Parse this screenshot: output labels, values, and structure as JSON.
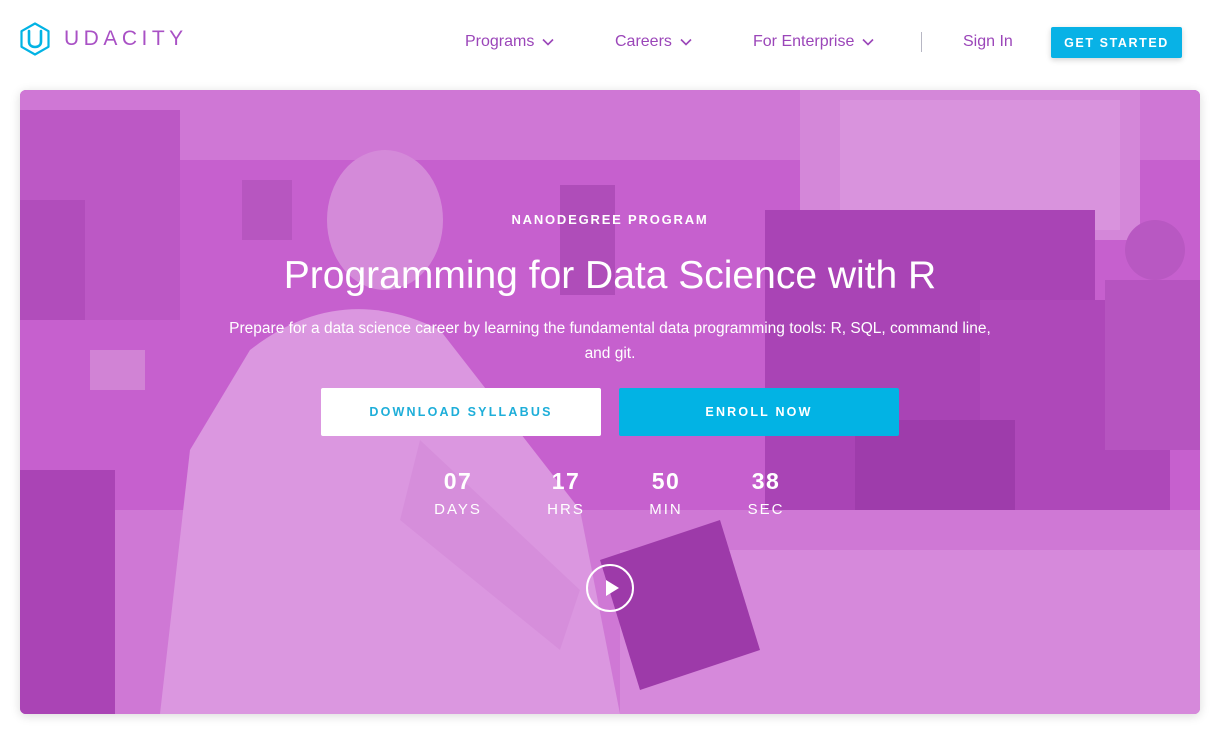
{
  "header": {
    "logo_text": "UDACITY",
    "nav": [
      {
        "label": "Programs"
      },
      {
        "label": "Careers"
      },
      {
        "label": "For Enterprise"
      }
    ],
    "sign_in": "Sign In",
    "cta": "GET STARTED"
  },
  "hero": {
    "eyebrow": "NANODEGREE PROGRAM",
    "title": "Programming for Data Science with R",
    "subtitle": "Prepare for a data science career by learning the fundamental data programming tools: R, SQL, command line, and git.",
    "download_button": "DOWNLOAD SYLLABUS",
    "enroll_button": "ENROLL NOW",
    "countdown": [
      {
        "value": "07",
        "label": "DAYS"
      },
      {
        "value": "17",
        "label": "HRS"
      },
      {
        "value": "50",
        "label": "MIN"
      },
      {
        "value": "38",
        "label": "SEC"
      }
    ]
  },
  "colors": {
    "brand_purple": "#a951c5",
    "nav_purple": "#9b46b9",
    "accent_cyan": "#02b3e4",
    "hero_tint": "#c96ad0"
  },
  "icons": {
    "logo": "udacity-u-logo-icon",
    "nav_chevron": "chevron-down-icon",
    "play": "play-icon"
  }
}
